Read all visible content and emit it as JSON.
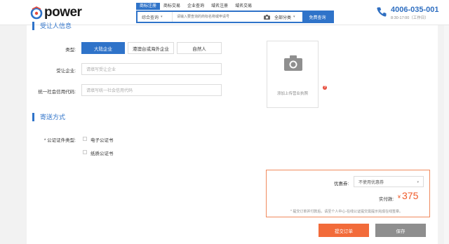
{
  "brand": {
    "logo_text": "power",
    "accent_color": "#2f73c9"
  },
  "search": {
    "tabs": [
      "商标注册",
      "商标交易",
      "企业查询",
      "域名注册",
      "域名交易"
    ],
    "active_tab": 0,
    "scope": "综合查询",
    "placeholder": "请输入要查询的商标名称或申请号",
    "category": "全部分类",
    "button": "免费查询"
  },
  "contact": {
    "phone": "4006-035-001",
    "hours": "8:30-17:00（工作日）"
  },
  "transferee": {
    "section_title": "受让人信息",
    "type_label": "类型:",
    "types": [
      "大陆企业",
      "港澳台或海外企业",
      "自然人"
    ],
    "active_type": 0,
    "company_label": "受让企业:",
    "company_placeholder": "请填写受让企业",
    "credit_label": "统一社会信用代码:",
    "credit_placeholder": "请填写统一社会信用代码",
    "upload_text": "添加上传营业执照",
    "help_glyph": "?"
  },
  "delivery": {
    "section_title": "寄送方式",
    "cert_label": "* 公证证件类型:",
    "options": [
      "电子公证书",
      "纸质公证书"
    ]
  },
  "summary": {
    "coupon_label": "优惠券:",
    "coupon_value": "不使用优惠券",
    "pay_label": "实付款:",
    "currency": "¥",
    "amount": "375",
    "note": "* 提交订单并付款后，请至个人中心-在线公证提交需提示完成在线签章。",
    "submit_label": "提交订单",
    "save_label": "保存",
    "submit_color": "#f26b3a"
  }
}
